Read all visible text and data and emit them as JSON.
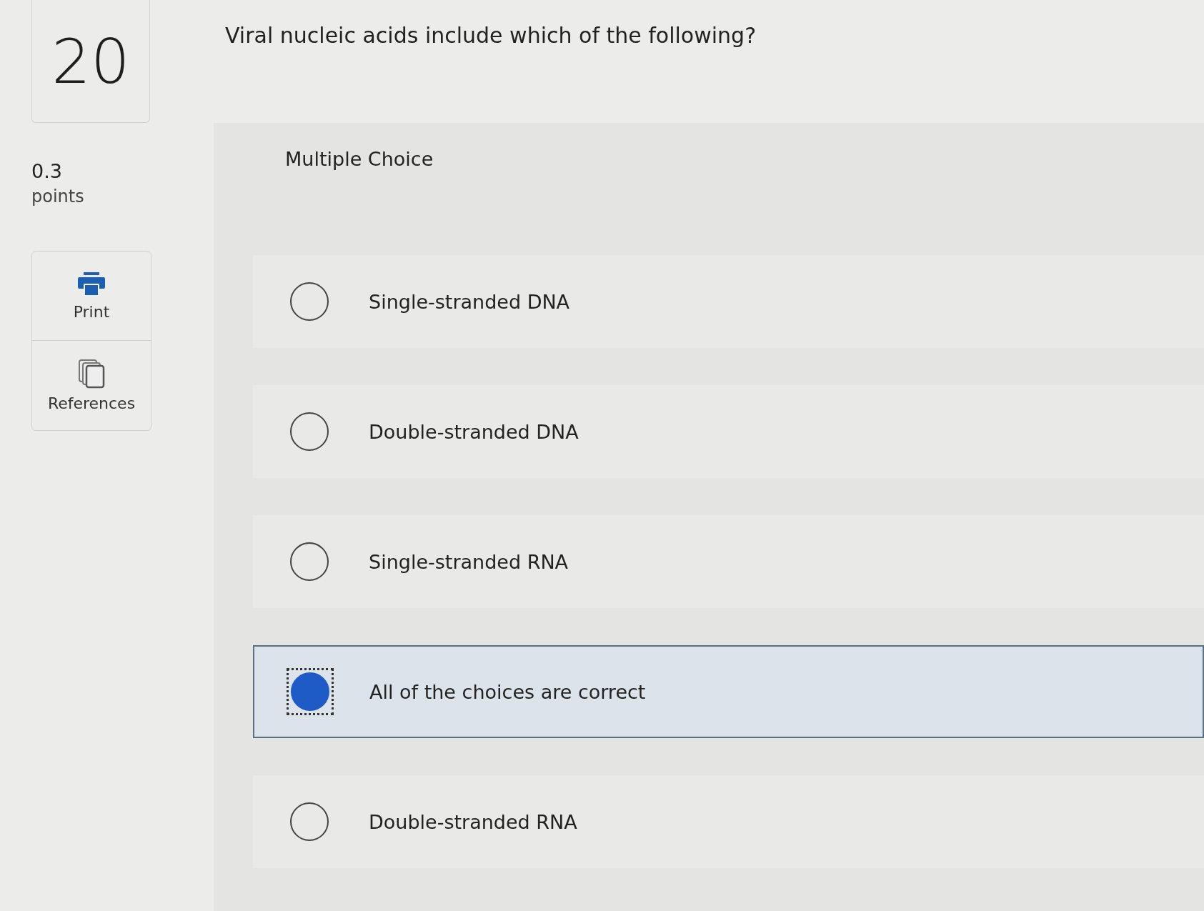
{
  "question": {
    "number": "20",
    "points_value": "0.3",
    "points_label": "points",
    "text": "Viral nucleic acids include which of the following?"
  },
  "tools": [
    {
      "label": "Print",
      "kind": "print"
    },
    {
      "label": "References",
      "kind": "references"
    }
  ],
  "answer_type": "Multiple Choice",
  "choices": [
    {
      "label": "Single-stranded DNA",
      "selected": false
    },
    {
      "label": "Double-stranded DNA",
      "selected": false
    },
    {
      "label": "Single-stranded RNA",
      "selected": false
    },
    {
      "label": "All of the choices are correct",
      "selected": true
    },
    {
      "label": "Double-stranded RNA",
      "selected": false
    }
  ]
}
